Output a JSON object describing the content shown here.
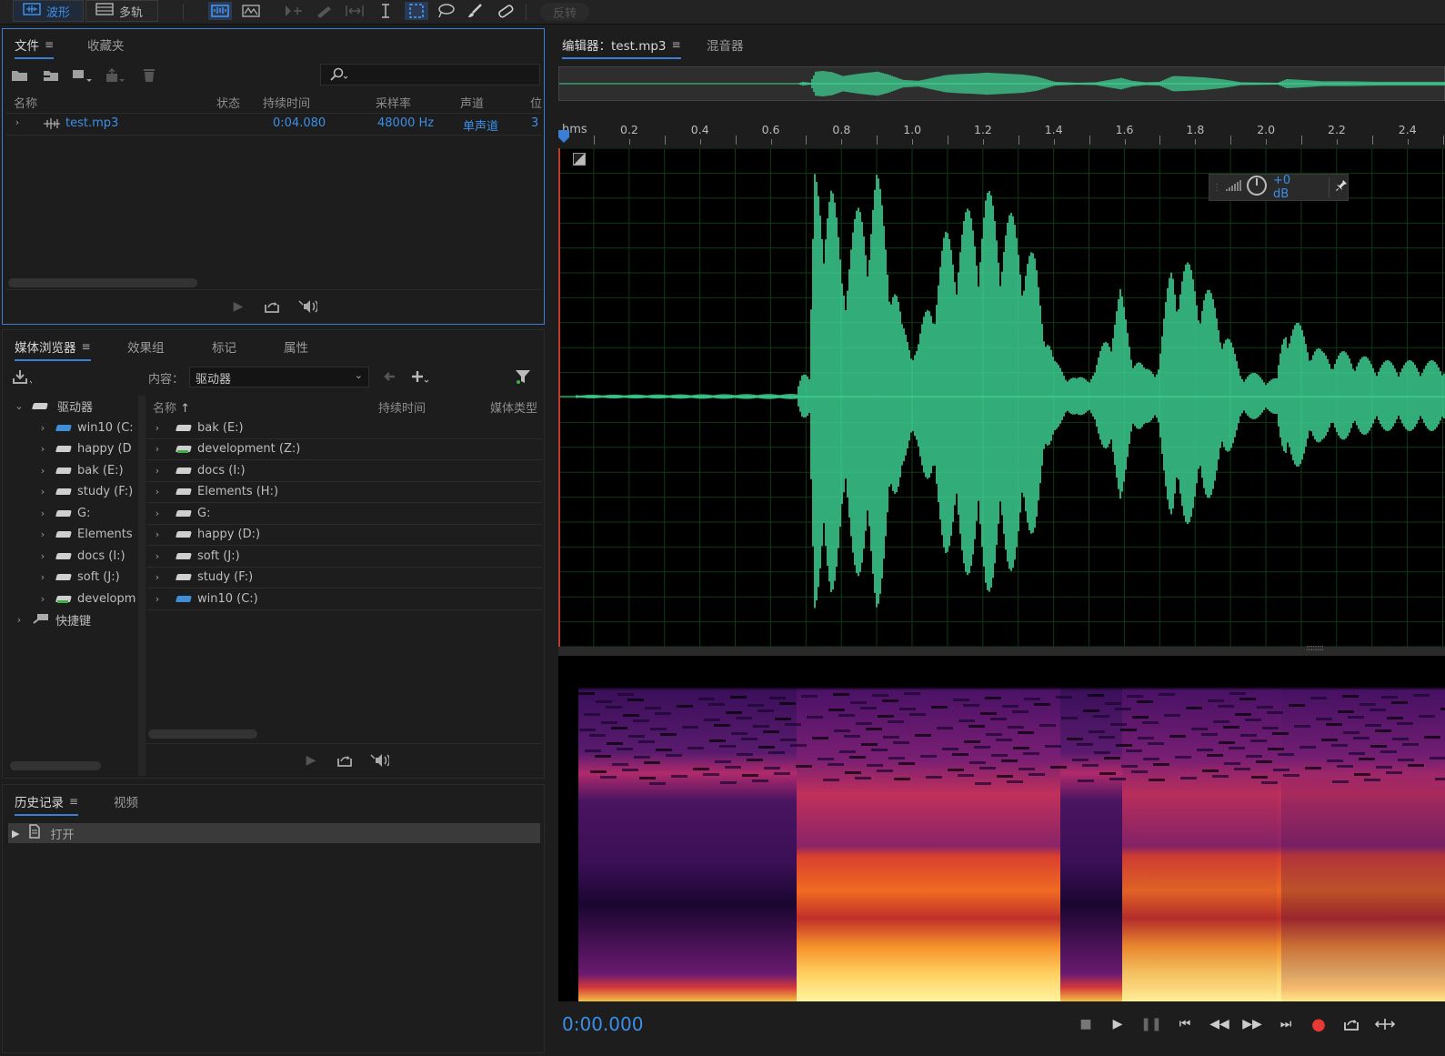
{
  "topbar": {
    "waveform_label": "波形",
    "multitrack_label": "多轨",
    "invert_label": "反转"
  },
  "files_panel": {
    "tabs": [
      "文件",
      "收藏夹"
    ],
    "columns": [
      "名称",
      "状态",
      "持续时间",
      "采样率",
      "声道",
      "位"
    ],
    "file": {
      "name": "test.mp3",
      "duration": "0:04.080",
      "sample_rate": "48000 Hz",
      "channel": "单声道",
      "bit": "3"
    }
  },
  "media_panel": {
    "tabs": [
      "媒体浏览器",
      "效果组",
      "标记",
      "属性"
    ],
    "content_label": "内容：",
    "content_value": "驱动器",
    "tree_root": "驱动器",
    "tree_items": [
      "win10 (C:",
      "happy (D",
      "bak (E:)",
      "study (F:)",
      "G:",
      "Elements",
      "docs (I:)",
      "soft (J:)",
      "developm"
    ],
    "shortcuts_label": "快捷键",
    "list_columns": [
      "名称",
      "持续时间",
      "媒体类型"
    ],
    "list_items": [
      "bak (E:)",
      "development (Z:)",
      "docs (I:)",
      "Elements (H:)",
      "G:",
      "happy (D:)",
      "soft (J:)",
      "study (F:)",
      "win10 (C:)"
    ]
  },
  "history_panel": {
    "tabs": [
      "历史记录",
      "视频"
    ],
    "entry": "打开"
  },
  "editor": {
    "tabs": [
      "编辑器：test.mp3",
      "混音器"
    ],
    "ruler_unit": "hms",
    "ruler_labels": [
      "0.2",
      "0.4",
      "0.6",
      "0.8",
      "1.0",
      "1.2",
      "1.4",
      "1.6",
      "1.8",
      "2.0",
      "2.2",
      "2.4"
    ],
    "gain": "+0 dB",
    "time": "0:00.000"
  },
  "colors": {
    "accent": "#3b8fe8",
    "waveform": "#3fd896",
    "grid": "#0f3a14"
  }
}
